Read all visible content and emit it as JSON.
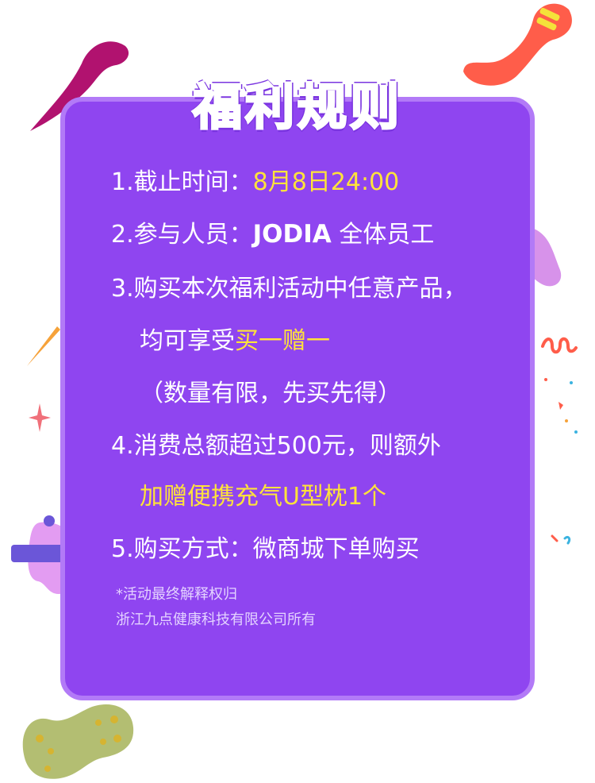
{
  "title": "福利规则",
  "rules": {
    "r1": {
      "label": "1.截止时间：",
      "value": "8月8日24:00"
    },
    "r2": {
      "label": "2.参与人员：",
      "brand": "JODIA",
      "rest": " 全体员工"
    },
    "r3": {
      "line1": "3.购买本次福利活动中任意产品，",
      "line2_prefix": "均可享受",
      "line2_highlight": "买一赠一",
      "line3": "（数量有限，先买先得）"
    },
    "r4": {
      "line1": "4.消费总额超过500元，则额外",
      "line2": "加赠便携充气U型枕1个"
    },
    "r5": {
      "text": "5.购买方式：微商城下单购买"
    }
  },
  "footer": {
    "note1": "*活动最终解释权归",
    "note2": "浙江九点健康科技有限公司所有"
  },
  "colors": {
    "card": "#8f45f0",
    "card_border": "#b27af7",
    "highlight": "#ffe33a"
  }
}
